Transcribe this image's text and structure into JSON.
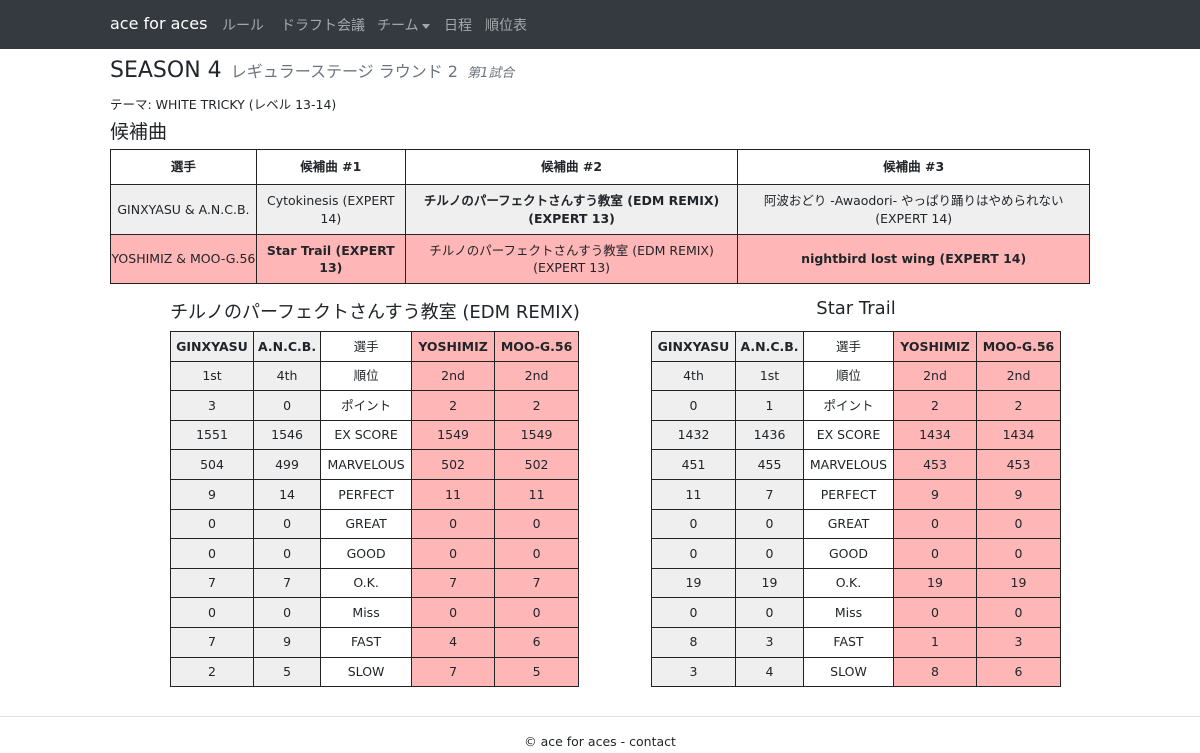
{
  "nav": {
    "brand": "ace for aces",
    "links": [
      "ルール",
      "ドラフト会議",
      "チーム",
      "日程",
      "順位表"
    ]
  },
  "header": {
    "season": "SEASON 4",
    "stage": "レギュラーステージ ラウンド 2",
    "match": "第1試合",
    "theme": "テーマ: WHITE TRICKY (レベル 13-14)",
    "section": "候補曲"
  },
  "candidates": {
    "headers": [
      "選手",
      "候補曲 #1",
      "候補曲 #2",
      "候補曲 #3"
    ],
    "rows": [
      {
        "player": "GINXYASU & A.N.C.B.",
        "songs": [
          "Cytokinesis (EXPERT 14)",
          "チルノのパーフェクトさんすう教室 (EDM REMIX) (EXPERT 13)",
          "阿波おどり -Awaodori- やっぱり踊りはやめられない (EXPERT 14)"
        ]
      },
      {
        "player": "YOSHIMIZ & MOO-G.56",
        "songs": [
          "Star Trail (EXPERT 13)",
          "チルノのパーフェクトさんすう教室 (EDM REMIX) (EXPERT 13)",
          "nightbird lost wing (EXPERT 14)"
        ]
      }
    ]
  },
  "results": [
    {
      "song": "チルノのパーフェクトさんすう教室 (EDM REMIX)",
      "players": [
        "GINXYASU",
        "A.N.C.B.",
        "YOSHIMIZ",
        "MOO-G.56"
      ],
      "label_header": "選手",
      "rows": [
        {
          "label": "順位",
          "values": [
            "1st",
            "4th",
            "2nd",
            "2nd"
          ]
        },
        {
          "label": "ポイント",
          "values": [
            "3",
            "0",
            "2",
            "2"
          ]
        },
        {
          "label": "EX SCORE",
          "values": [
            "1551",
            "1546",
            "1549",
            "1549"
          ]
        },
        {
          "label": "MARVELOUS",
          "values": [
            "504",
            "499",
            "502",
            "502"
          ]
        },
        {
          "label": "PERFECT",
          "values": [
            "9",
            "14",
            "11",
            "11"
          ]
        },
        {
          "label": "GREAT",
          "values": [
            "0",
            "0",
            "0",
            "0"
          ]
        },
        {
          "label": "GOOD",
          "values": [
            "0",
            "0",
            "0",
            "0"
          ]
        },
        {
          "label": "O.K.",
          "values": [
            "7",
            "7",
            "7",
            "7"
          ]
        },
        {
          "label": "Miss",
          "values": [
            "0",
            "0",
            "0",
            "0"
          ]
        },
        {
          "label": "FAST",
          "values": [
            "7",
            "9",
            "4",
            "6"
          ]
        },
        {
          "label": "SLOW",
          "values": [
            "2",
            "5",
            "7",
            "5"
          ]
        }
      ]
    },
    {
      "song": "Star Trail",
      "players": [
        "GINXYASU",
        "A.N.C.B.",
        "YOSHIMIZ",
        "MOO-G.56"
      ],
      "label_header": "選手",
      "rows": [
        {
          "label": "順位",
          "values": [
            "4th",
            "1st",
            "2nd",
            "2nd"
          ]
        },
        {
          "label": "ポイント",
          "values": [
            "0",
            "1",
            "2",
            "2"
          ]
        },
        {
          "label": "EX SCORE",
          "values": [
            "1432",
            "1436",
            "1434",
            "1434"
          ]
        },
        {
          "label": "MARVELOUS",
          "values": [
            "451",
            "455",
            "453",
            "453"
          ]
        },
        {
          "label": "PERFECT",
          "values": [
            "11",
            "7",
            "9",
            "9"
          ]
        },
        {
          "label": "GREAT",
          "values": [
            "0",
            "0",
            "0",
            "0"
          ]
        },
        {
          "label": "GOOD",
          "values": [
            "0",
            "0",
            "0",
            "0"
          ]
        },
        {
          "label": "O.K.",
          "values": [
            "19",
            "19",
            "19",
            "19"
          ]
        },
        {
          "label": "Miss",
          "values": [
            "0",
            "0",
            "0",
            "0"
          ]
        },
        {
          "label": "FAST",
          "values": [
            "8",
            "3",
            "1",
            "3"
          ]
        },
        {
          "label": "SLOW",
          "values": [
            "3",
            "4",
            "8",
            "6"
          ]
        }
      ]
    }
  ],
  "colors": {
    "navbar": "#343a40",
    "team_a_row": "#efefef",
    "team_b_row": "#ffb6b6"
  },
  "footer": {
    "copyright": "© ace for aces - ",
    "contact": "contact"
  }
}
